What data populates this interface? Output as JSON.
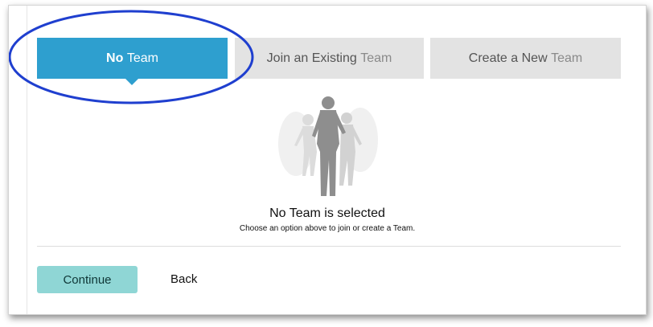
{
  "tabs": [
    {
      "word1": "No",
      "word2": "Team",
      "active": true
    },
    {
      "word1": "Join an Existing",
      "word2": "Team",
      "active": false
    },
    {
      "word1": "Create a New",
      "word2": "Team",
      "active": false
    }
  ],
  "status": {
    "title": "No Team is selected",
    "subtitle": "Choose an option above to join or create a Team."
  },
  "actions": {
    "continue_label": "Continue",
    "back_label": "Back"
  },
  "colors": {
    "active_tab": "#2e9fcf",
    "inactive_tab": "#e3e3e3",
    "continue_button": "#8fd6d5",
    "highlight_ellipse": "#1f3fcf"
  },
  "icons": {
    "illustration": "runners-silhouette-icon",
    "tab_caret": "caret-down-icon"
  }
}
